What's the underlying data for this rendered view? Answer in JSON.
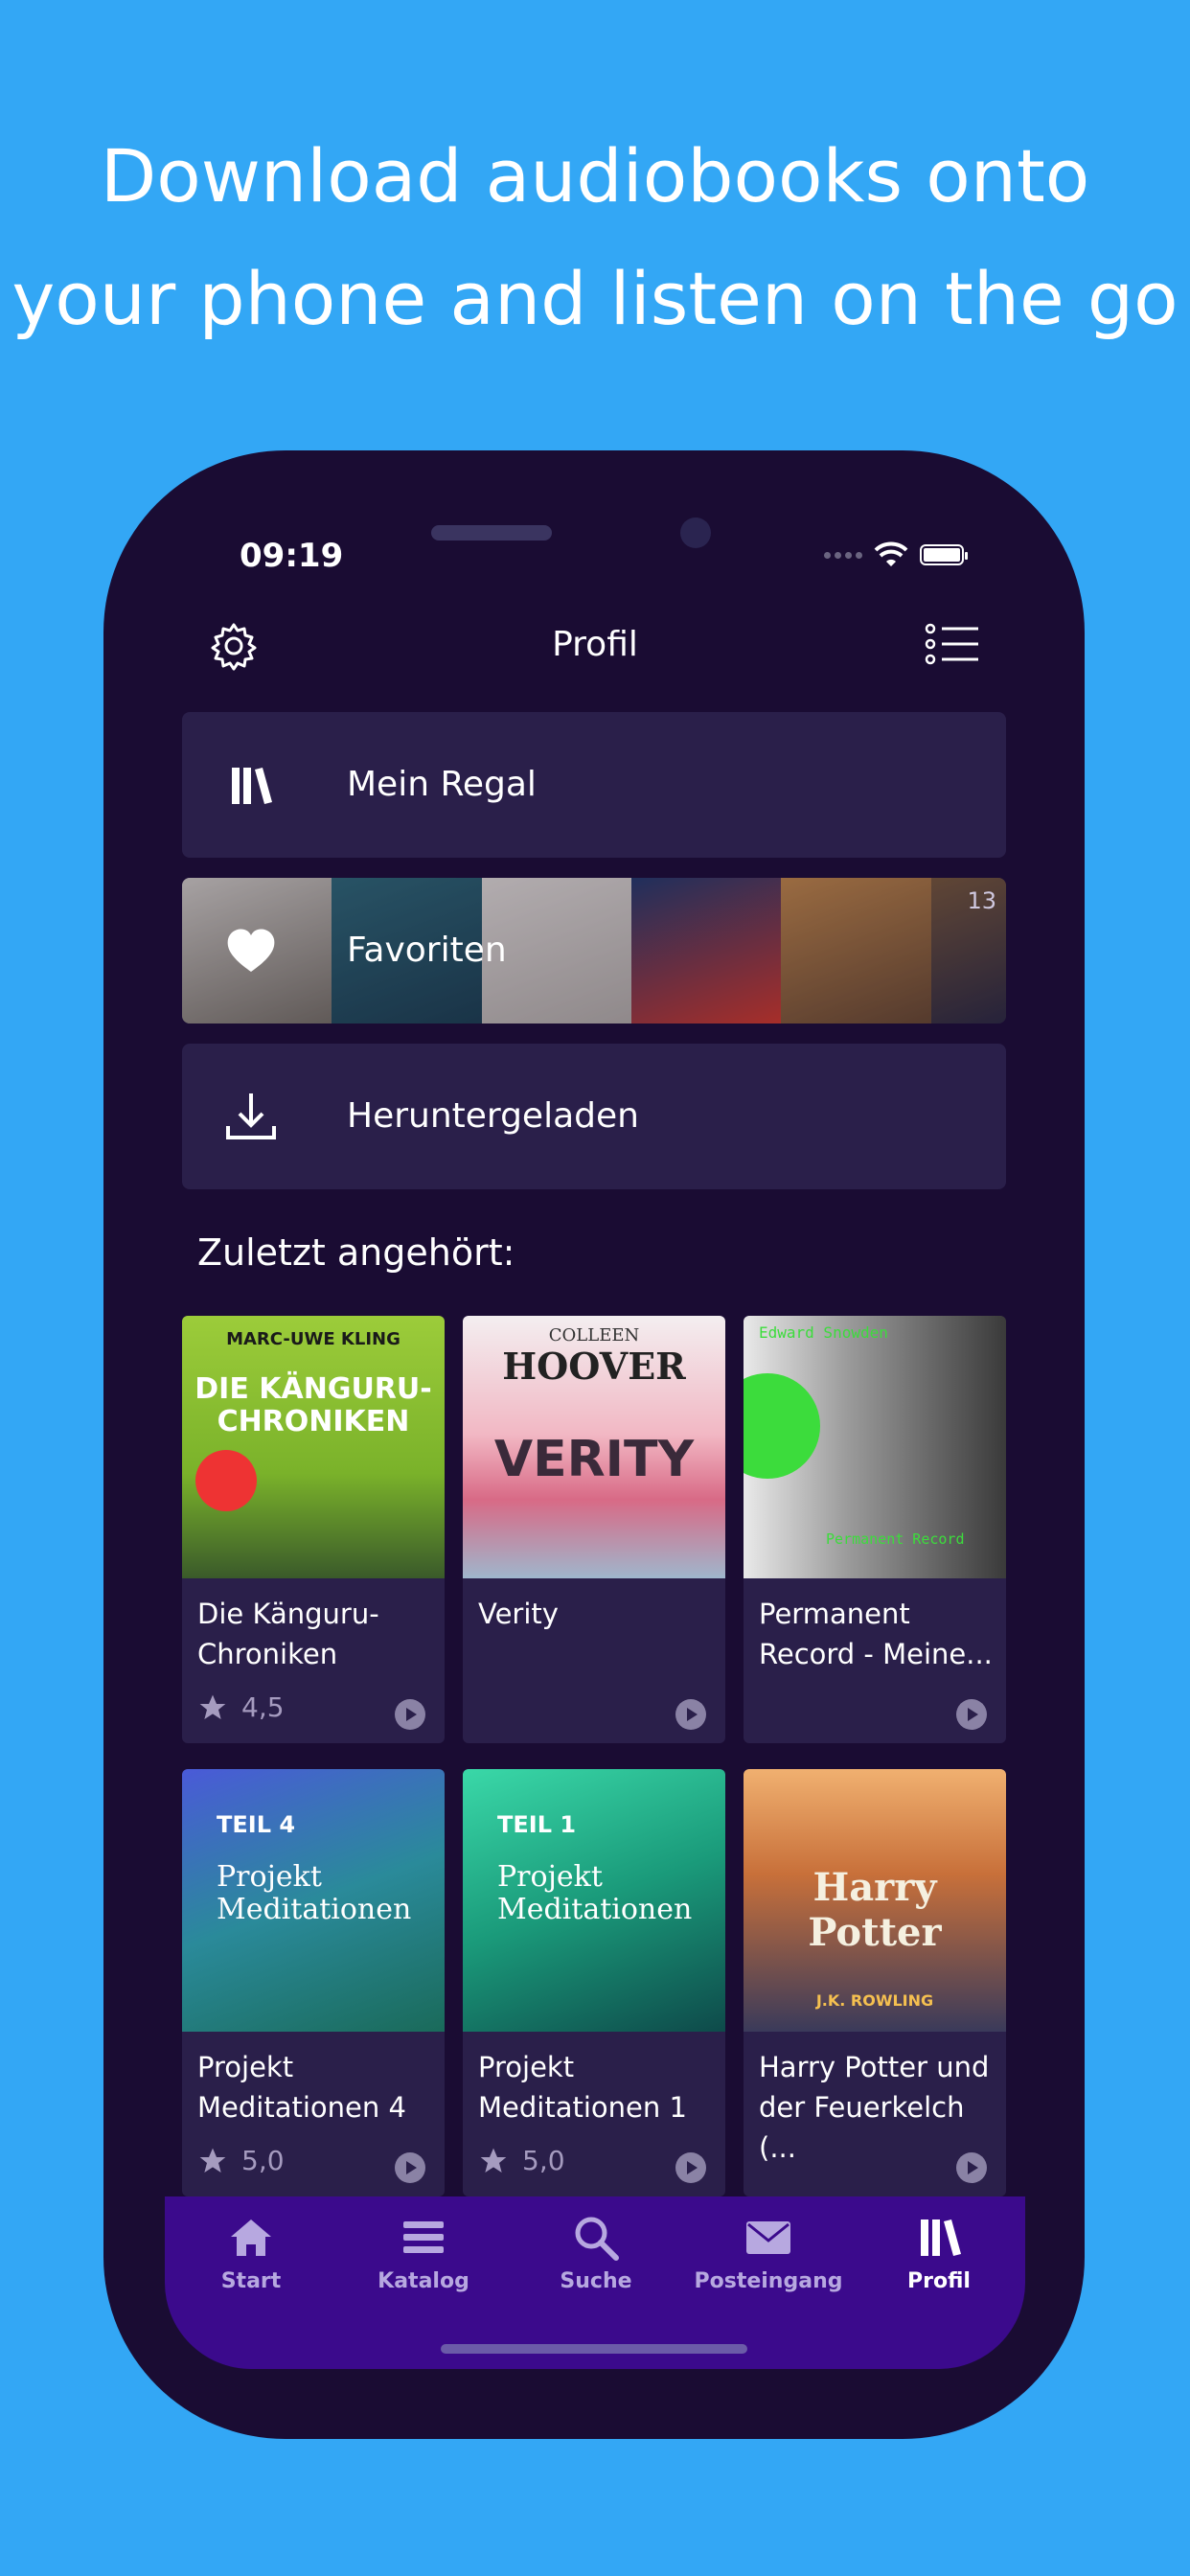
{
  "headline": {
    "line1": "Download audiobooks onto",
    "line2": "your phone and listen on the go"
  },
  "status": {
    "time": "09:19"
  },
  "header": {
    "title": "Profil"
  },
  "menu": {
    "regal": "Mein Regal",
    "favoriten": "Favoriten",
    "favoriten_count": "13",
    "heruntergeladen": "Heruntergeladen"
  },
  "section": {
    "title": "Zuletzt angehört:"
  },
  "books": [
    {
      "title": "Die Känguru-Chroniken",
      "rating": "4,5",
      "cover_author": "MARC-UWE KLING",
      "cover_title": "DIE KÄNGURU-CHRONIKEN"
    },
    {
      "title": "Verity",
      "rating": "",
      "cover_author": "COLLEEN",
      "cover_author2": "HOOVER",
      "cover_title": "VERITY"
    },
    {
      "title": "Permanent Record - Meine...",
      "rating": "",
      "cover_author": "Edward Snowden",
      "cover_title": "Permanent Record"
    },
    {
      "title": "Projekt Meditationen 4",
      "rating": "5,0",
      "cover_part": "TEIL 4",
      "cover_title": "Projekt Meditationen"
    },
    {
      "title": "Projekt Meditationen 1",
      "rating": "5,0",
      "cover_part": "TEIL 1",
      "cover_title": "Projekt Meditationen"
    },
    {
      "title": "Harry Potter und der Feuerkelch (...",
      "rating": "",
      "cover_author": "J.K. ROWLING",
      "cover_title": "Harry Potter"
    }
  ],
  "tabs": [
    {
      "label": "Start"
    },
    {
      "label": "Katalog"
    },
    {
      "label": "Suche"
    },
    {
      "label": "Posteingang"
    },
    {
      "label": "Profil"
    }
  ],
  "colors": {
    "background": "#33a7f5",
    "phone": "#1a0c33",
    "row": "#2a1f4a",
    "tabbar": "#3b0a8c"
  }
}
